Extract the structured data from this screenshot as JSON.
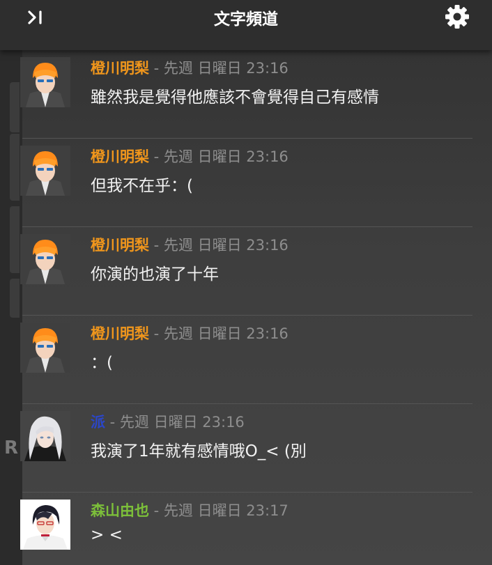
{
  "header": {
    "collapse_icon_text": ">I",
    "title": "文字頻道",
    "settings_icon": "gear-icon"
  },
  "background": {
    "partial_letter": "R"
  },
  "colors": {
    "author_orange": "#f0961c",
    "author_blue": "#2b46c8",
    "author_green": "#7cbf3a",
    "timestamp_gray": "#8e8e8e"
  },
  "messages": [
    {
      "author": "橙川明梨",
      "time": " - 先週 日曜日 23:16",
      "text": "雖然我是覺得他應該不會覺得自己有感情"
    },
    {
      "author": "橙川明梨",
      "time": " - 先週 日曜日 23:16",
      "text": "但我不在乎：("
    },
    {
      "author": "橙川明梨",
      "time": " - 先週 日曜日 23:16",
      "text": "你演的也演了十年"
    },
    {
      "author": "橙川明梨",
      "time": " - 先週 日曜日 23:16",
      "text": "：("
    },
    {
      "author": "派",
      "time": " - 先週 日曜日 23:16",
      "text": "我演了1年就有感情哦O_< (別"
    },
    {
      "author": "森山由也",
      "time": " - 先週 日曜日 23:17",
      "text": "> <"
    }
  ]
}
